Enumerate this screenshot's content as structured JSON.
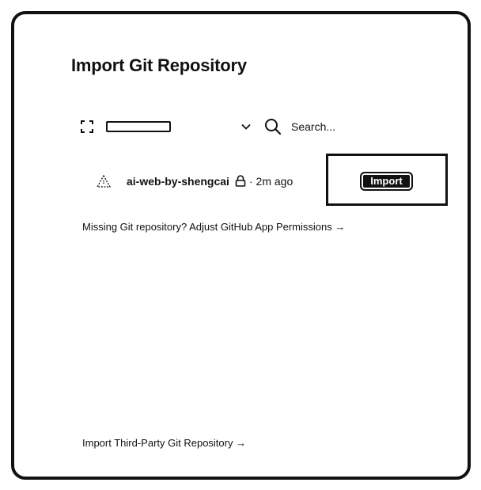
{
  "dialog": {
    "title": "Import Git Repository"
  },
  "toolbar": {
    "scope_icon": "scope-frame-icon",
    "account_select": {
      "selected_value": "",
      "chevron_icon": "chevron-down-icon"
    },
    "search": {
      "icon": "search-icon",
      "placeholder": "Search..."
    }
  },
  "repositories": [
    {
      "icon": "repo-triangle-icon",
      "name": "ai-web-by-shengcai",
      "private_icon": "lock-icon",
      "updated": "· 2m ago",
      "action_label": "Import"
    }
  ],
  "links": {
    "missing_repo": "Missing Git repository? Adjust GitHub App Permissions →",
    "third_party": "Import Third-Party Git Repository →"
  },
  "colors": {
    "foreground": "#111111",
    "background": "#ffffff"
  }
}
